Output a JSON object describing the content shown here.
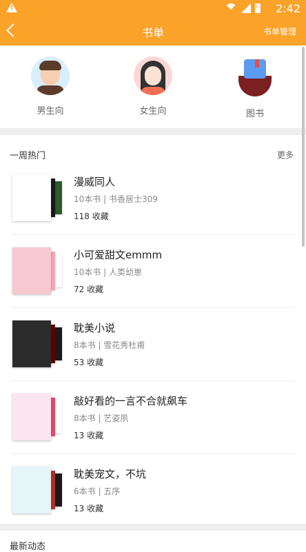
{
  "status": {
    "time": "2:42"
  },
  "header": {
    "title": "书单",
    "right_link": "书单管理"
  },
  "categories": [
    {
      "label": "男生向",
      "icon": "male-avatar-icon"
    },
    {
      "label": "女生向",
      "icon": "female-avatar-icon"
    },
    {
      "label": "图书",
      "icon": "books-icon"
    }
  ],
  "section": {
    "title": "一周热门",
    "more": "更多"
  },
  "items": [
    {
      "title": "漫威同人",
      "meta": "10本书 | 书香居士309",
      "favorites": "118 收藏",
      "colors": [
        "#ffffff",
        "#1a1a1a",
        "#2b5b2b"
      ]
    },
    {
      "title": "小可爱甜文emmm",
      "meta": "10本书 | 人类幼崽",
      "favorites": "72 收藏",
      "colors": [
        "#f7c8cf",
        "#f4a6b4",
        "#ffffff"
      ]
    },
    {
      "title": "耽美小说",
      "meta": "8本书 | 雪花秀杜甫",
      "favorites": "53 收藏",
      "colors": [
        "#2b2b2b",
        "#600000",
        "#1a1a1a"
      ]
    },
    {
      "title": "敲好看的一言不合就飙车",
      "meta": "8本书 | 艺姿夙",
      "favorites": "13 收藏",
      "colors": [
        "#fbe6ef",
        "#e14c6b",
        "#ffffff"
      ]
    },
    {
      "title": "耽美宠文，不坑",
      "meta": "6本书 | 五序",
      "favorites": "13 收藏",
      "colors": [
        "#e6f5f7",
        "#b52e2e",
        "#1a1a1a"
      ]
    }
  ],
  "next_section": {
    "title": "最新动态"
  }
}
